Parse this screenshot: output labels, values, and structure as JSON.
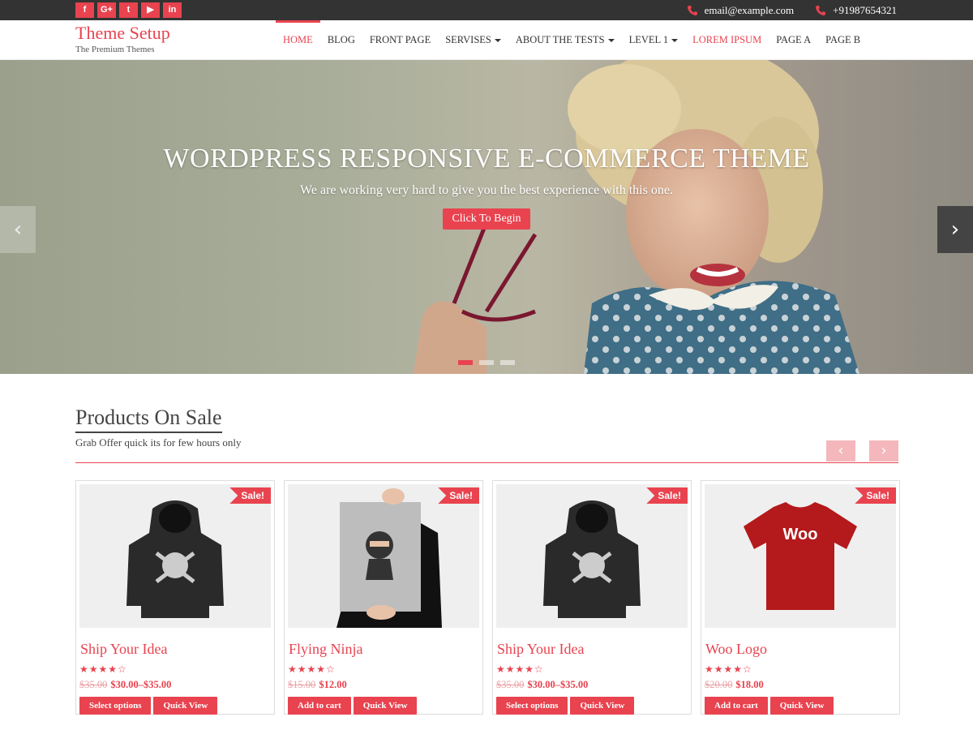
{
  "topbar": {
    "social": [
      {
        "icon": "facebook-icon",
        "glyph": "f"
      },
      {
        "icon": "google-plus-icon",
        "glyph": "G+"
      },
      {
        "icon": "twitter-icon",
        "glyph": "t"
      },
      {
        "icon": "youtube-icon",
        "glyph": "▶"
      },
      {
        "icon": "linkedin-icon",
        "glyph": "in"
      }
    ],
    "email": "email@example.com",
    "phone": "+91987654321"
  },
  "header": {
    "site_title": "Theme Setup",
    "tagline": "The Premium Themes",
    "nav": [
      {
        "label": "Home",
        "active": true
      },
      {
        "label": "Blog"
      },
      {
        "label": "Front Page"
      },
      {
        "label": "Servises",
        "dropdown": true
      },
      {
        "label": "About The Tests",
        "dropdown": true
      },
      {
        "label": "Level 1",
        "dropdown": true
      },
      {
        "label": "Lorem Ipsum",
        "highlight": true
      },
      {
        "label": "Page A"
      },
      {
        "label": "Page B"
      }
    ]
  },
  "hero": {
    "title": "WordPress Responsive E-Commerce Theme",
    "subtitle": "We are working very hard to give you the best experience with this one.",
    "button": "Click To Begin",
    "prev_glyph": "‹",
    "next_glyph": "›",
    "slides": 3,
    "active_slide": 1
  },
  "products": {
    "title": "Products On Sale",
    "subtitle": "Grab Offer quick its for few hours only",
    "prev_glyph": "‹",
    "next_glyph": "›",
    "items": [
      {
        "name": "Ship Your Idea",
        "sale": "Sale!",
        "rating": 4,
        "old_price": "$35.00",
        "new_price": "$30.00–$35.00",
        "btn1": "Select options",
        "btn2": "Quick View",
        "image": "hoodie"
      },
      {
        "name": "Flying Ninja",
        "sale": "Sale!",
        "rating": 4,
        "old_price": "$15.00",
        "new_price": "$12.00",
        "btn1": "Add to cart",
        "btn2": "Quick View",
        "image": "poster"
      },
      {
        "name": "Ship Your Idea",
        "sale": "Sale!",
        "rating": 4,
        "old_price": "$35.00",
        "new_price": "$30.00–$35.00",
        "btn1": "Select options",
        "btn2": "Quick View",
        "image": "hoodie"
      },
      {
        "name": "Woo Logo",
        "sale": "Sale!",
        "rating": 4,
        "old_price": "$20.00",
        "new_price": "$18.00",
        "btn1": "Add to cart",
        "btn2": "Quick View",
        "image": "tshirt",
        "tshirt_text": "Woo"
      }
    ]
  },
  "colors": {
    "accent": "#e8434f",
    "topbar": "#333333"
  }
}
